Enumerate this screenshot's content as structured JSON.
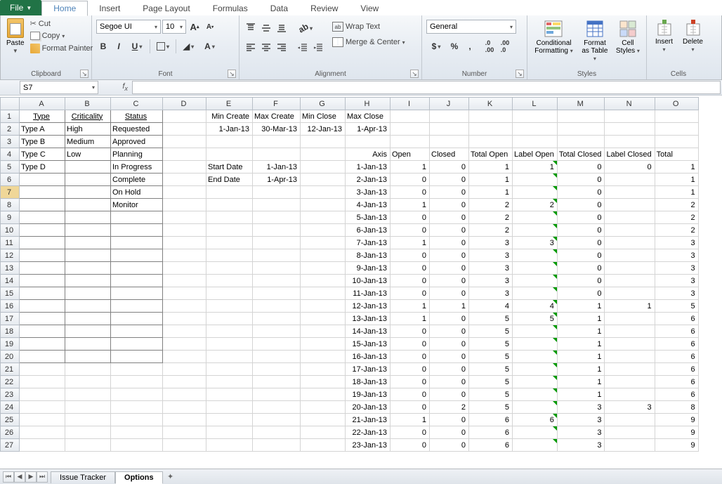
{
  "tabs": {
    "file": "File",
    "home": "Home",
    "insert": "Insert",
    "pagelayout": "Page Layout",
    "formulas": "Formulas",
    "data": "Data",
    "review": "Review",
    "view": "View"
  },
  "clipboard": {
    "paste": "Paste",
    "cut": "Cut",
    "copy": "Copy",
    "fmtpainter": "Format Painter",
    "label": "Clipboard"
  },
  "font": {
    "name": "Segoe UI",
    "size": "10",
    "label": "Font"
  },
  "alignment": {
    "wrap": "Wrap Text",
    "merge": "Merge & Center",
    "label": "Alignment"
  },
  "number": {
    "format": "General",
    "label": "Number"
  },
  "styles": {
    "cond": "Conditional Formatting",
    "table": "Format as Table",
    "cell": "Cell Styles",
    "label": "Styles"
  },
  "cells": {
    "insert": "Insert",
    "delete": "Delete",
    "label": "Cells"
  },
  "namebox": "S7",
  "cols": [
    "A",
    "B",
    "C",
    "D",
    "E",
    "F",
    "G",
    "H",
    "I",
    "J",
    "K",
    "L",
    "M",
    "N",
    "O"
  ],
  "row1": {
    "a": "Type",
    "b": "Criticality",
    "c": "Status",
    "e": "Min Create",
    "f": "Max Create",
    "g": "Min Close",
    "h": "Max Close"
  },
  "row2": {
    "a": "Type A",
    "b": "High",
    "c": "Requested",
    "e": "1-Jan-13",
    "f": "30-Mar-13",
    "g": "12-Jan-13",
    "h": "1-Apr-13"
  },
  "row3": {
    "a": "Type B",
    "b": "Medium",
    "c": "Approved"
  },
  "row4": {
    "a": "Type C",
    "b": "Low",
    "c": "Planning",
    "h": "Axis",
    "i": "Open",
    "j": "Closed",
    "k": "Total Open",
    "l": "Label Open",
    "m": "Total Closed",
    "n": "Label Closed",
    "o": "Total"
  },
  "row5": {
    "a": "Type D",
    "c": "In Progress",
    "e": "Start Date",
    "f": "1-Jan-13"
  },
  "row6": {
    "c": "Complete",
    "e": "End Date",
    "f": "1-Apr-13"
  },
  "row7": {
    "c": "On Hold"
  },
  "row8": {
    "c": "Monitor"
  },
  "table": [
    {
      "h": "1-Jan-13",
      "i": "1",
      "j": "0",
      "k": "1",
      "l": "1",
      "m": "0",
      "n": "0",
      "o": "1"
    },
    {
      "h": "2-Jan-13",
      "i": "0",
      "j": "0",
      "k": "1",
      "l": "",
      "m": "0",
      "n": "",
      "o": "1"
    },
    {
      "h": "3-Jan-13",
      "i": "0",
      "j": "0",
      "k": "1",
      "l": "",
      "m": "0",
      "n": "",
      "o": "1"
    },
    {
      "h": "4-Jan-13",
      "i": "1",
      "j": "0",
      "k": "2",
      "l": "2",
      "m": "0",
      "n": "",
      "o": "2"
    },
    {
      "h": "5-Jan-13",
      "i": "0",
      "j": "0",
      "k": "2",
      "l": "",
      "m": "0",
      "n": "",
      "o": "2"
    },
    {
      "h": "6-Jan-13",
      "i": "0",
      "j": "0",
      "k": "2",
      "l": "",
      "m": "0",
      "n": "",
      "o": "2"
    },
    {
      "h": "7-Jan-13",
      "i": "1",
      "j": "0",
      "k": "3",
      "l": "3",
      "m": "0",
      "n": "",
      "o": "3"
    },
    {
      "h": "8-Jan-13",
      "i": "0",
      "j": "0",
      "k": "3",
      "l": "",
      "m": "0",
      "n": "",
      "o": "3"
    },
    {
      "h": "9-Jan-13",
      "i": "0",
      "j": "0",
      "k": "3",
      "l": "",
      "m": "0",
      "n": "",
      "o": "3"
    },
    {
      "h": "10-Jan-13",
      "i": "0",
      "j": "0",
      "k": "3",
      "l": "",
      "m": "0",
      "n": "",
      "o": "3"
    },
    {
      "h": "11-Jan-13",
      "i": "0",
      "j": "0",
      "k": "3",
      "l": "",
      "m": "0",
      "n": "",
      "o": "3"
    },
    {
      "h": "12-Jan-13",
      "i": "1",
      "j": "1",
      "k": "4",
      "l": "4",
      "m": "1",
      "n": "1",
      "o": "5"
    },
    {
      "h": "13-Jan-13",
      "i": "1",
      "j": "0",
      "k": "5",
      "l": "5",
      "m": "1",
      "n": "",
      "o": "6"
    },
    {
      "h": "14-Jan-13",
      "i": "0",
      "j": "0",
      "k": "5",
      "l": "",
      "m": "1",
      "n": "",
      "o": "6"
    },
    {
      "h": "15-Jan-13",
      "i": "0",
      "j": "0",
      "k": "5",
      "l": "",
      "m": "1",
      "n": "",
      "o": "6"
    },
    {
      "h": "16-Jan-13",
      "i": "0",
      "j": "0",
      "k": "5",
      "l": "",
      "m": "1",
      "n": "",
      "o": "6"
    },
    {
      "h": "17-Jan-13",
      "i": "0",
      "j": "0",
      "k": "5",
      "l": "",
      "m": "1",
      "n": "",
      "o": "6"
    },
    {
      "h": "18-Jan-13",
      "i": "0",
      "j": "0",
      "k": "5",
      "l": "",
      "m": "1",
      "n": "",
      "o": "6"
    },
    {
      "h": "19-Jan-13",
      "i": "0",
      "j": "0",
      "k": "5",
      "l": "",
      "m": "1",
      "n": "",
      "o": "6"
    },
    {
      "h": "20-Jan-13",
      "i": "0",
      "j": "2",
      "k": "5",
      "l": "",
      "m": "3",
      "n": "3",
      "o": "8"
    },
    {
      "h": "21-Jan-13",
      "i": "1",
      "j": "0",
      "k": "6",
      "l": "6",
      "m": "3",
      "n": "",
      "o": "9"
    },
    {
      "h": "22-Jan-13",
      "i": "0",
      "j": "0",
      "k": "6",
      "l": "",
      "m": "3",
      "n": "",
      "o": "9"
    },
    {
      "h": "23-Jan-13",
      "i": "0",
      "j": "0",
      "k": "6",
      "l": "",
      "m": "3",
      "n": "",
      "o": "9"
    }
  ],
  "sheets": {
    "s1": "Issue Tracker",
    "s2": "Options"
  }
}
